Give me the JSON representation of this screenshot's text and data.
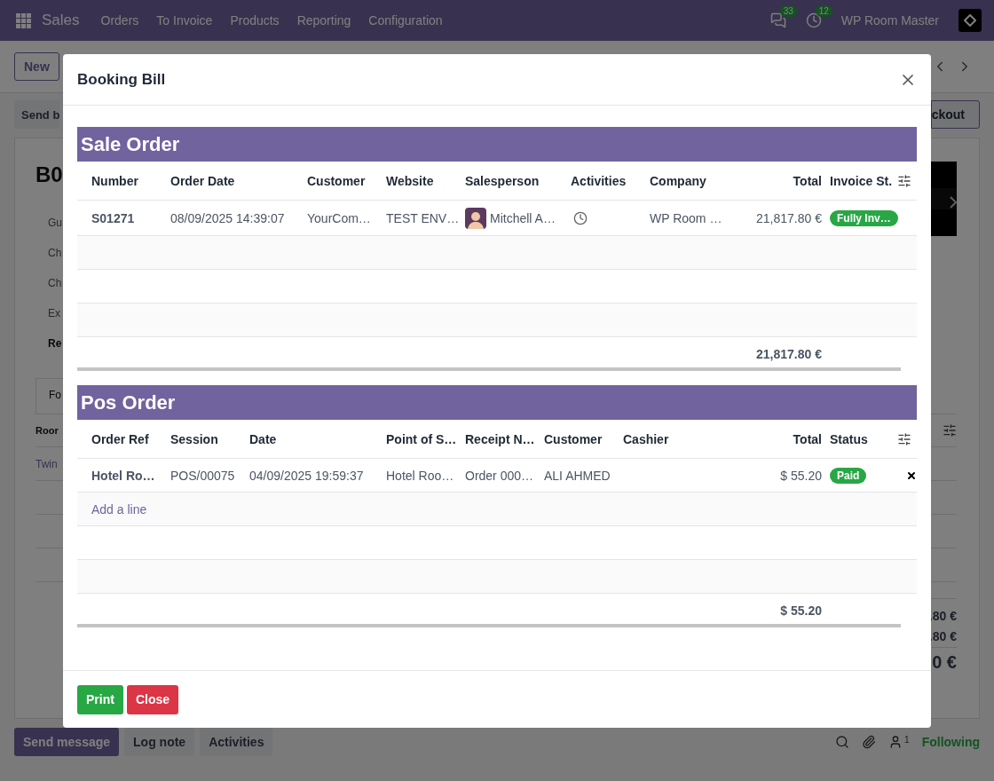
{
  "navbar": {
    "app": "Sales",
    "menu": [
      "Orders",
      "To Invoice",
      "Products",
      "Reporting",
      "Configuration"
    ],
    "messages_count": "33",
    "activities_count": "12",
    "company": "WP Room Master"
  },
  "control_panel": {
    "new_button": "New"
  },
  "background_form": {
    "status_buttons": [
      "Send b",
      "ckout"
    ],
    "title": "B0",
    "field_labels": [
      {
        "label": "Gu",
        "bold": false
      },
      {
        "label": "Ch",
        "bold": false
      },
      {
        "label": "Ch",
        "bold": false
      },
      {
        "label": "Ex",
        "bold": false
      },
      {
        "label": "Re",
        "bold": true
      }
    ],
    "tab": "Fo",
    "table_header": "Roor",
    "row": "Twin",
    "subtotals": [
      ".80 €",
      ".80 €"
    ],
    "grand_total": "0 €"
  },
  "chatter": {
    "buttons": [
      {
        "label": "Send message",
        "primary": true
      },
      {
        "label": "Log note",
        "primary": false
      },
      {
        "label": "Activities",
        "primary": false
      }
    ],
    "followers_count": "1",
    "follow_label": "Following"
  },
  "dialog": {
    "title": "Booking Bill",
    "sections": [
      {
        "title": "Sale Order",
        "columns": [
          {
            "label": "Number"
          },
          {
            "label": "Order Date"
          },
          {
            "label": "Customer"
          },
          {
            "label": "Website"
          },
          {
            "label": "Salesperson"
          },
          {
            "label": "Activities"
          },
          {
            "label": "Company"
          },
          {
            "label": "Total"
          },
          {
            "label": "Invoice St."
          }
        ],
        "rows": [
          [
            {
              "kind": "bold",
              "text": "S01271"
            },
            {
              "kind": "text",
              "text": "08/09/2025 14:39:07"
            },
            {
              "kind": "text",
              "text": "YourCom…"
            },
            {
              "kind": "text",
              "text": "TEST ENV…"
            },
            {
              "kind": "person",
              "text": "Mitchell A…"
            },
            {
              "kind": "activity"
            },
            {
              "kind": "text",
              "text": "WP Room …"
            },
            {
              "kind": "money",
              "text": "21,817.80 €"
            },
            {
              "kind": "badge",
              "text": "Fully Inv…"
            }
          ]
        ],
        "total": "21,817.80 €"
      },
      {
        "title": "Pos Order",
        "columns": [
          {
            "label": "Order Ref"
          },
          {
            "label": "Session"
          },
          {
            "label": "Date"
          },
          {
            "label": "Point of S…"
          },
          {
            "label": "Receipt N…"
          },
          {
            "label": "Customer"
          },
          {
            "label": "Cashier"
          },
          {
            "label": "Total"
          },
          {
            "label": "Status"
          }
        ],
        "rows": [
          [
            {
              "kind": "bold",
              "text": "Hotel Ro…"
            },
            {
              "kind": "text",
              "text": "POS/00075"
            },
            {
              "kind": "text",
              "text": "04/09/2025 19:59:37"
            },
            {
              "kind": "text",
              "text": "Hotel Roo…"
            },
            {
              "kind": "text",
              "text": "Order 000…"
            },
            {
              "kind": "text",
              "text": "ALI AHMED"
            },
            {
              "kind": "empty"
            },
            {
              "kind": "money",
              "text": "$ 55.20"
            },
            {
              "kind": "badge",
              "text": "Paid"
            },
            {
              "kind": "delete"
            }
          ]
        ],
        "add_line": "Add a line",
        "total": "$ 55.20"
      }
    ],
    "buttons": [
      {
        "label": "Print",
        "kind": "primary"
      },
      {
        "label": "Close",
        "kind": "danger"
      }
    ]
  }
}
